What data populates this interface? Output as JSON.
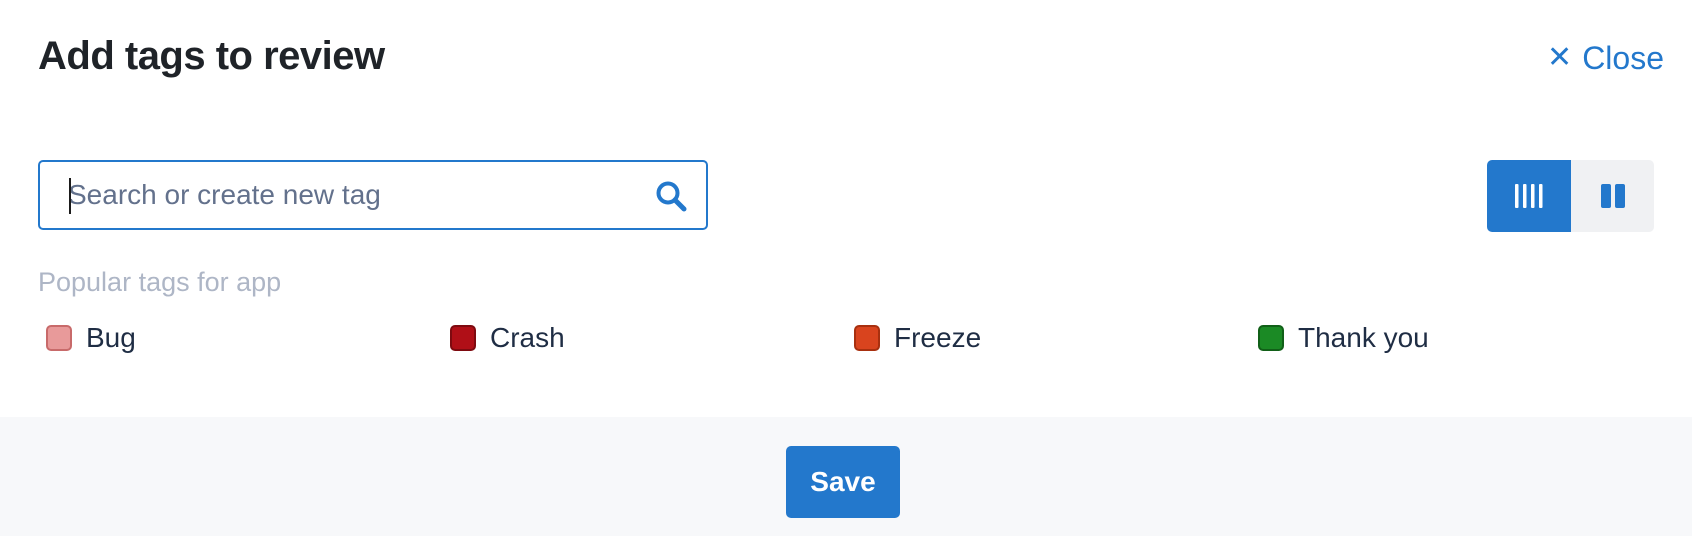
{
  "dialog": {
    "title": "Add tags to review",
    "close_label": "Close"
  },
  "search": {
    "placeholder": "Search or create new tag",
    "value": ""
  },
  "icons": {
    "close": "close-icon",
    "search": "search-icon",
    "view_columns": "columns-view-icon",
    "view_split": "split-view-icon"
  },
  "view_toggle": {
    "active": "columns"
  },
  "popular": {
    "label": "Popular tags for app",
    "tags": [
      {
        "label": "Bug",
        "color": "#e89a9a",
        "border": "#c86a6a"
      },
      {
        "label": "Crash",
        "color": "#b00f17",
        "border": "#7e0a10"
      },
      {
        "label": "Freeze",
        "color": "#d9441e",
        "border": "#a8300f"
      },
      {
        "label": "Thank you",
        "color": "#1b8a25",
        "border": "#116018"
      }
    ]
  },
  "footer": {
    "save_label": "Save"
  },
  "colors": {
    "accent": "#2378cc",
    "footer_bg": "#f7f8fa"
  }
}
